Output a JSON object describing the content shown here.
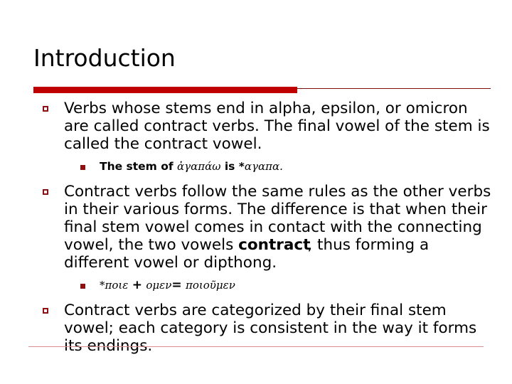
{
  "slide": {
    "title": "Introduction",
    "accent_color": "#c00000",
    "marker_color": "#8d1111",
    "rule_color": "#d98f8f",
    "background": "#ffffff",
    "bullets": [
      {
        "level": 1,
        "marker": "square-outline-bullet",
        "text": "Verbs whose stems end in alpha, epsilon, or omicron are called contract verbs.  The final vowel of the stem is called the contract vowel."
      },
      {
        "level": 2,
        "marker": "square-filled-bullet",
        "lead": "The stem of ",
        "greek_1": "ἀγαπάω",
        "mid": " is *",
        "greek_2": "αγαπα",
        "tail": "."
      },
      {
        "level": 1,
        "marker": "square-outline-bullet",
        "text_before_bold": "Contract verbs follow the same rules as the other verbs in their various forms.  The difference is that when their final stem vowel comes in contact with the connecting vowel, the two vowels ",
        "bold_word": "contract",
        "text_after_bold": ", thus forming a different vowel or dipthong."
      },
      {
        "level": 2,
        "marker": "square-filled-bullet",
        "formula_star": "*",
        "formula_term1": "ποιε",
        "formula_op1": "+",
        "formula_term2": "ομεν",
        "formula_op2": "=",
        "formula_result": "ποιοῦμεν"
      },
      {
        "level": 1,
        "marker": "square-outline-bullet",
        "text": "Contract verbs are categorized by their final stem vowel; each category is consistent in the way it forms its endings."
      }
    ]
  }
}
